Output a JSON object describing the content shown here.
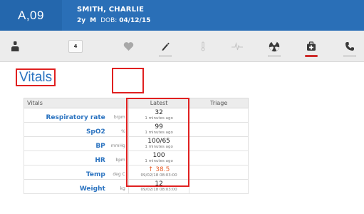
{
  "patient": {
    "bed": "A,09",
    "name": "SMITH, CHARLIE",
    "age": "2y",
    "sex": "M",
    "dob_label": "DOB:",
    "dob": "04/12/15"
  },
  "toolbar": {
    "items": [
      {
        "icon": "user-icon"
      },
      {
        "icon": "count-badge",
        "text": "4"
      },
      {
        "icon": "heart-icon",
        "selected": true
      },
      {
        "icon": "pen-icon",
        "status_bar": "white"
      },
      {
        "icon": "thermometer-icon"
      },
      {
        "icon": "pulse-icon"
      },
      {
        "icon": "radiation-icon",
        "status_bar": "white"
      },
      {
        "icon": "first-aid-kit-icon",
        "status_bar": "red"
      },
      {
        "icon": "phone-icon",
        "status_bar": "white"
      }
    ],
    "colors": {
      "icon": "#3a3a3a",
      "icon_faint": "#c4c4c4",
      "alert": "#e53935"
    }
  },
  "page": {
    "title": "Vitals",
    "title_color": "#2b73c0",
    "highlight_color": "#e02020"
  },
  "vitals_table": {
    "headers": {
      "name": "Vitals",
      "latest": "Latest",
      "triage": "Triage"
    },
    "rows": [
      {
        "label": "Respiratory rate",
        "unit": "brpm",
        "value": "32",
        "time": "1 minutes ago",
        "triage": ""
      },
      {
        "label": "SpO2",
        "unit": "%",
        "value": "99",
        "time": "1 minutes ago",
        "triage": ""
      },
      {
        "label": "BP",
        "unit": "mmHg",
        "value": "100/65",
        "time": "1 minutes ago",
        "triage": ""
      },
      {
        "label": "HR",
        "unit": "bpm",
        "value": "100",
        "time": "1 minutes ago",
        "triage": ""
      },
      {
        "label": "Temp",
        "unit": "deg C",
        "value": "↑ 38.5",
        "time": "09/02/18 08:03:00",
        "triage": "",
        "abnormal": true
      },
      {
        "label": "Weight",
        "unit": "kg",
        "value": "12",
        "time": "09/02/18 08:03:00",
        "triage": ""
      }
    ]
  }
}
